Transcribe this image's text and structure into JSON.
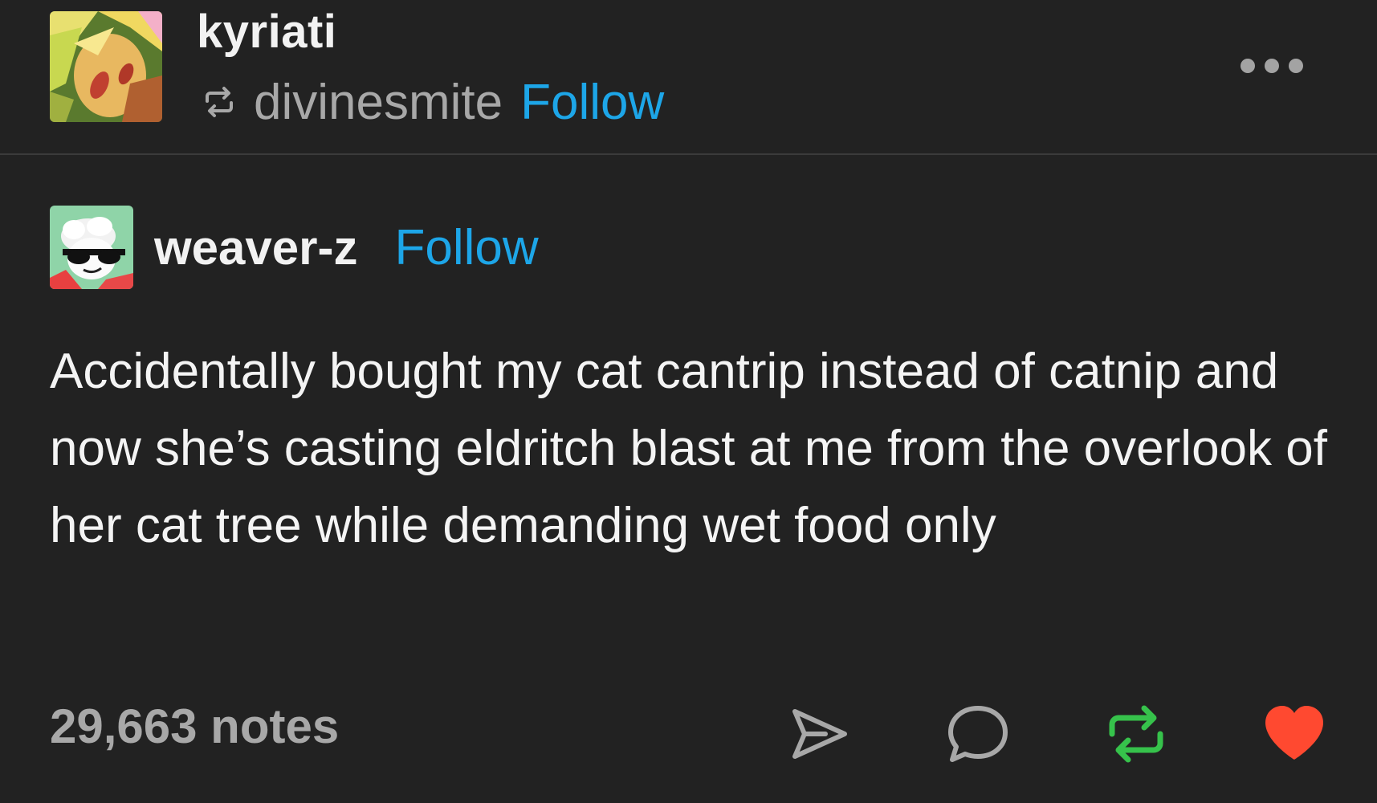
{
  "header": {
    "username": "kyriati",
    "reblogged_from": "divinesmite",
    "follow_label": "Follow"
  },
  "trail": {
    "username": "weaver-z",
    "follow_label": "Follow",
    "text": "Accidentally bought my cat cantrip instead of catnip and now she’s casting eldritch blast at me from the overlook of her cat tree while demanding wet food only"
  },
  "footer": {
    "notes": "29,663 notes"
  },
  "icons": {
    "more": "more-options-icon",
    "reblog_small": "reblog-icon",
    "share": "share-icon",
    "reply": "reply-icon",
    "reblog": "reblog-icon",
    "like": "heart-icon"
  },
  "colors": {
    "background": "#222222",
    "link": "#1da6e8",
    "reblog_active": "#36c24b",
    "like_active": "#ff4930",
    "muted_text": "#a8a8a8"
  }
}
